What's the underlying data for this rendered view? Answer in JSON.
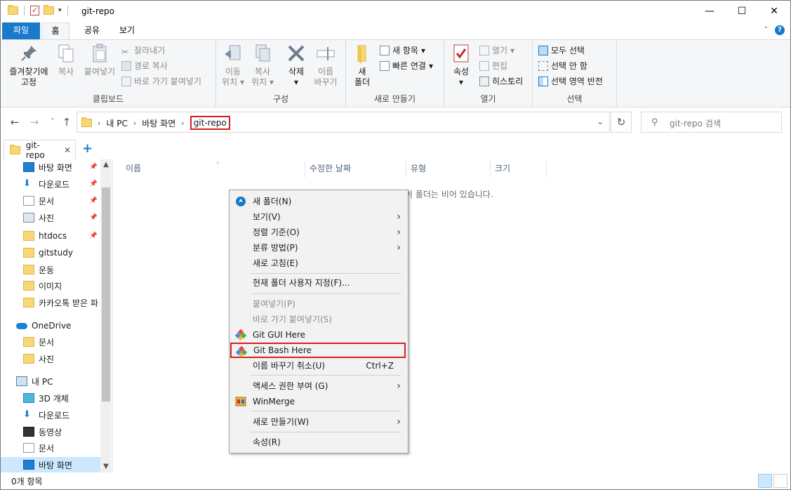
{
  "window": {
    "title": "git-repo",
    "controls": {
      "minimize": "—",
      "maximize": "☐",
      "close": "✕"
    }
  },
  "ribbon_tabs": {
    "file": "파일",
    "home": "홈",
    "share": "공유",
    "view": "보기"
  },
  "ribbon": {
    "clipboard": {
      "label": "클립보드",
      "pin": [
        "즐겨찾기에",
        "고정"
      ],
      "copy": "복사",
      "paste": "붙여넣기",
      "cut": "잘라내기",
      "copy_path": "경로 복사",
      "paste_shortcut": "바로 가기 붙여넣기"
    },
    "organize": {
      "label": "구성",
      "move_to": [
        "이동",
        "위치"
      ],
      "copy_to": [
        "복사",
        "위치"
      ],
      "delete": "삭제",
      "rename": [
        "이름",
        "바꾸기"
      ]
    },
    "new": {
      "label": "새로 만들기",
      "new_folder": [
        "새",
        "폴더"
      ],
      "new_item": "새 항목",
      "easy_access": "빠른 연결"
    },
    "open": {
      "label": "열기",
      "properties": "속성",
      "open": "열기",
      "edit": "편집",
      "history": "히스토리"
    },
    "select": {
      "label": "선택",
      "select_all": "모두 선택",
      "select_none": "선택 안 함",
      "invert": "선택 영역 반전"
    }
  },
  "address": {
    "crumbs": [
      "내 PC",
      "바탕 화면",
      "git-repo"
    ],
    "search_placeholder": "git-repo 검색"
  },
  "folder_tab": {
    "label": "git-repo",
    "close": "✕",
    "add": "+"
  },
  "nav": [
    {
      "label": "바탕 화면",
      "icon": "desktop-icon",
      "pinned": true
    },
    {
      "label": "다운로드",
      "icon": "download-icon",
      "pinned": true
    },
    {
      "label": "문서",
      "icon": "document-icon",
      "pinned": true
    },
    {
      "label": "사진",
      "icon": "picture-icon",
      "pinned": true
    },
    {
      "label": "htdocs",
      "icon": "folder-icon",
      "pinned": true
    },
    {
      "label": "gitstudy",
      "icon": "folder-icon",
      "pinned": false
    },
    {
      "label": "운동",
      "icon": "folder-icon",
      "pinned": false
    },
    {
      "label": "이미지",
      "icon": "folder-icon",
      "pinned": false
    },
    {
      "label": "카카오톡 받은 파",
      "icon": "folder-icon",
      "pinned": false
    },
    {
      "label": "OneDrive",
      "icon": "cloud-icon",
      "pinned": false
    },
    {
      "label": "문서",
      "icon": "folder-icon",
      "pinned": false
    },
    {
      "label": "사진",
      "icon": "folder-icon",
      "pinned": false
    },
    {
      "label": "내 PC",
      "icon": "pc-icon",
      "pinned": false
    },
    {
      "label": "3D 개체",
      "icon": "cube-icon",
      "pinned": false
    },
    {
      "label": "다운로드",
      "icon": "download-icon",
      "pinned": false
    },
    {
      "label": "동영상",
      "icon": "video-icon",
      "pinned": false
    },
    {
      "label": "문서",
      "icon": "document-icon",
      "pinned": false
    },
    {
      "label": "바탕 화면",
      "icon": "desktop-icon",
      "pinned": false
    }
  ],
  "columns": [
    "이름",
    "수정한 날짜",
    "유형",
    "크기"
  ],
  "empty_message": "이 폴더는 비어 있습니다.",
  "status": {
    "item_count": "0개 항목"
  },
  "context_menu": [
    {
      "label": "새 폴더(N)",
      "icon": "new-folder-icon"
    },
    {
      "label": "보기(V)",
      "submenu": true
    },
    {
      "label": "정렬 기준(O)",
      "submenu": true
    },
    {
      "label": "분류 방법(P)",
      "submenu": true
    },
    {
      "label": "새로 고침(E)"
    },
    {
      "label": "현재 폴더 사용자 지정(F)..."
    },
    {
      "label": "붙여넣기(P)",
      "disabled": true
    },
    {
      "label": "바로 가기 붙여넣기(S)",
      "disabled": true
    },
    {
      "label": "Git GUI Here",
      "icon": "git-gui-icon"
    },
    {
      "label": "Git Bash Here",
      "icon": "git-bash-icon",
      "highlighted": true
    },
    {
      "label": "이름 바꾸기 취소(U)",
      "shortcut": "Ctrl+Z"
    },
    {
      "label": "액세스 권한 부여 (G)",
      "submenu": true
    },
    {
      "label": "WinMerge",
      "icon": "winmerge-icon"
    },
    {
      "label": "새로 만들기(W)",
      "submenu": true
    },
    {
      "label": "속성(R)"
    }
  ],
  "colors": {
    "accent": "#1979ca",
    "highlight_border": "#d42020",
    "selection": "#cce8ff",
    "folder": "#f8d775"
  }
}
